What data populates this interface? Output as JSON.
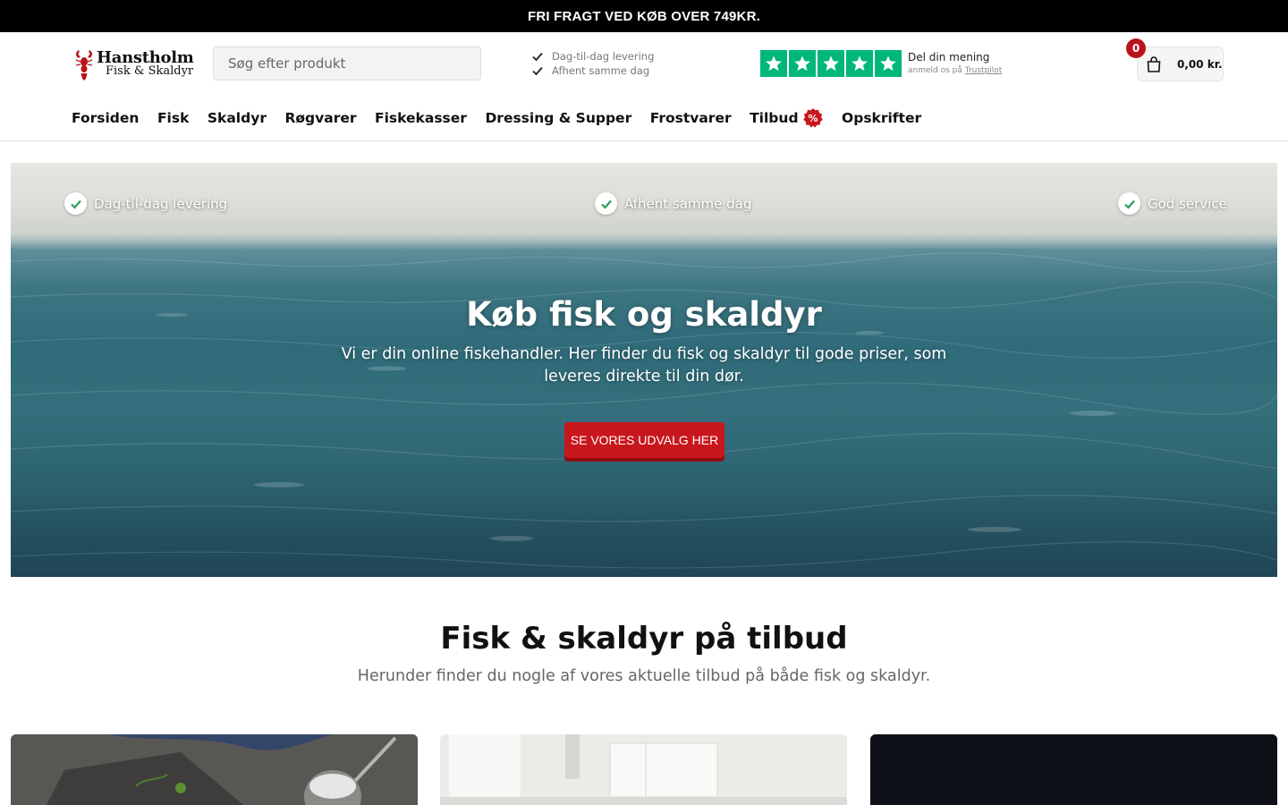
{
  "topbar": {
    "text": "FRI FRAGT VED KØB OVER 749KR."
  },
  "logo": {
    "line1": "Hanstholm",
    "line2": "Fisk & Skaldyr",
    "icon": "lobster-icon"
  },
  "search": {
    "placeholder": "Søg efter produkt",
    "value": ""
  },
  "header_usps": [
    "Dag-til-dag levering",
    "Afhent samme dag"
  ],
  "trustpilot": {
    "title": "Del din mening",
    "sub_prefix": "anmeld os på",
    "link": "Trustpilot",
    "stars": 5,
    "star_color": "#00b67a"
  },
  "cart": {
    "count": "0",
    "total": "0,00 kr.",
    "icon": "shopping-bag-icon"
  },
  "nav": {
    "items": [
      "Forsiden",
      "Fisk",
      "Skaldyr",
      "Røgvarer",
      "Fiskekasser",
      "Dressing & Supper",
      "Frostvarer",
      "Tilbud",
      "Opskrifter"
    ],
    "tilbud_badge": "%"
  },
  "hero": {
    "usps": [
      "Dag-til-dag levering",
      "Afhent samme dag",
      "God service"
    ],
    "title": "Køb fisk og skaldyr",
    "text": "Vi er din online fiskehandler. Her finder du fisk og skaldyr til gode priser, som leveres direkte til din dør.",
    "button": "SE VORES UDVALG HER"
  },
  "offers": {
    "title": "Fisk & skaldyr på tilbud",
    "subtitle": "Herunder finder du nogle af vores aktuelle tilbud på både fisk og skaldyr."
  },
  "colors": {
    "accent": "#c8161d",
    "trustpilot": "#00b67a",
    "check": "#2e9c5b"
  }
}
